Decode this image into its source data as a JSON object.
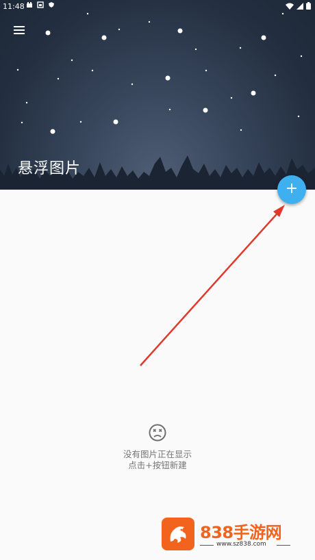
{
  "status_bar": {
    "time": "11:48"
  },
  "header": {
    "title": "悬浮图片"
  },
  "fab": {
    "label": "+"
  },
  "empty_state": {
    "line1": "没有图片正在显示",
    "line2": "点击+按钮新建"
  },
  "watermark": {
    "title": "838手游网",
    "url": "www.sz838.com"
  },
  "colors": {
    "fab": "#3fb0ef",
    "arrow": "#e0392b",
    "header_dark": "#1d2837",
    "watermark": "#f2641e"
  }
}
